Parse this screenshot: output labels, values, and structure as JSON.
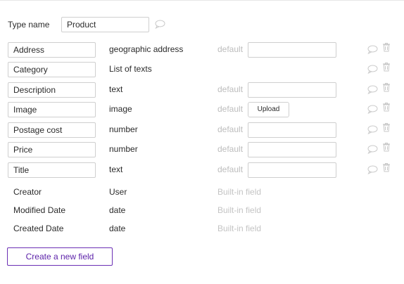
{
  "type_name": {
    "label": "Type name",
    "value": "Product"
  },
  "default_label": "default",
  "builtin_label": "Built-in field",
  "upload_label": "Upload",
  "fields": [
    {
      "name": "Address",
      "type": "geographic address",
      "default": "input"
    },
    {
      "name": "Category",
      "type": "List of texts",
      "default": "none"
    },
    {
      "name": "Description",
      "type": "text",
      "default": "input"
    },
    {
      "name": "Image",
      "type": "image",
      "default": "upload"
    },
    {
      "name": "Postage cost",
      "type": "number",
      "default": "input"
    },
    {
      "name": "Price",
      "type": "number",
      "default": "input"
    },
    {
      "name": "Title",
      "type": "text",
      "default": "input"
    }
  ],
  "builtin_fields": [
    {
      "name": "Creator",
      "type": "User"
    },
    {
      "name": "Modified Date",
      "type": "date"
    },
    {
      "name": "Created Date",
      "type": "date"
    }
  ],
  "create_button_label": "Create a new field",
  "colors": {
    "accent": "#5a1fa8",
    "muted": "#bdbdbd"
  },
  "icons": {
    "comment": "speech-bubble-icon",
    "delete": "trash-icon"
  }
}
